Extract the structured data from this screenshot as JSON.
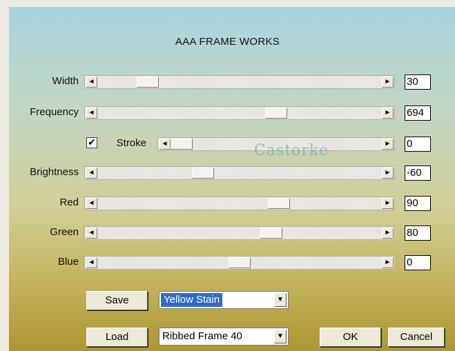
{
  "title": "AAA FRAME WORKS",
  "sliders": [
    {
      "label": "Width",
      "value": "30",
      "position": 0.15
    },
    {
      "label": "Frequency",
      "value": "694",
      "position": 0.64
    },
    {
      "label": "Stroke",
      "value": "0",
      "position": 0.0,
      "checked": true
    },
    {
      "label": "Brightness",
      "value": "-60",
      "position": 0.36
    },
    {
      "label": "Red",
      "value": "90",
      "position": 0.65
    },
    {
      "label": "Green",
      "value": "80",
      "position": 0.62
    },
    {
      "label": "Blue",
      "value": "0",
      "position": 0.5
    }
  ],
  "watermark": "Castorke",
  "buttons": {
    "save": "Save",
    "load": "Load",
    "ok": "OK",
    "cancel": "Cancel"
  },
  "presets": {
    "save_selected": "Yellow Stain",
    "load_selected": "Ribbed Frame 40"
  },
  "icons": {
    "scroll_left": "◄",
    "scroll_right": "►",
    "dropdown": "▼",
    "check": "✔"
  },
  "colors": {
    "selection": "#316ac5",
    "gradient_top": "#a9d3df",
    "gradient_bottom": "#ad9734"
  }
}
